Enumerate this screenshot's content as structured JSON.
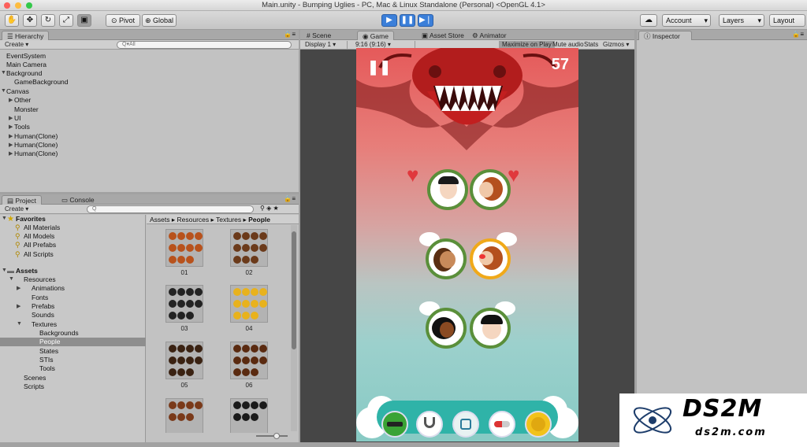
{
  "window": {
    "title": "Main.unity - Bumping Uglies - PC, Mac & Linux Standalone (Personal) <OpenGL 4.1>"
  },
  "toolbar": {
    "pivot_label": "Pivot",
    "global_label": "Global",
    "account_label": "Account",
    "layers_label": "Layers",
    "layout_label": "Layout"
  },
  "hierarchy": {
    "tab_label": "Hierarchy",
    "create_label": "Create",
    "search_placeholder": "Q▾All",
    "items": [
      "EventSystem",
      "Main Camera",
      "Background",
      "GameBackground",
      "Canvas",
      "Other",
      "Monster",
      "UI",
      "Tools",
      "Human(Clone)",
      "Human(Clone)",
      "Human(Clone)"
    ]
  },
  "project": {
    "tab_label": "Project",
    "console_tab_label": "Console",
    "create_label": "Create",
    "favorites_label": "Favorites",
    "favorites": [
      "All Materials",
      "All Models",
      "All Prefabs",
      "All Scripts"
    ],
    "assets_label": "Assets",
    "assets_tree": [
      "Resources",
      "Animations",
      "Fonts",
      "Prefabs",
      "Sounds",
      "Textures",
      "Backgrounds",
      "People",
      "States",
      "STIs",
      "Tools",
      "Scenes",
      "Scripts"
    ],
    "breadcrumb": [
      "Assets",
      "Resources",
      "Textures",
      "People"
    ],
    "thumbnails": [
      "01",
      "02",
      "03",
      "04",
      "05",
      "06",
      "",
      ""
    ]
  },
  "scene_tabs": {
    "scene": "Scene",
    "game": "Game",
    "asset_store": "Asset Store",
    "animator": "Animator"
  },
  "game_bar": {
    "display": "Display 1",
    "aspect": "9:16 (9:16)",
    "maximize": "Maximize on Play",
    "mute": "Mute audio",
    "stats": "Stats",
    "gizmos": "Gizmos"
  },
  "game": {
    "score": "57",
    "pause_icon": "pause-icon",
    "tools": [
      "syringe-icon",
      "stethoscope-icon",
      "soap-icon",
      "pill-icon",
      "coin-icon"
    ]
  },
  "inspector": {
    "tab_label": "Inspector"
  },
  "watermark": {
    "brand": "DS2M",
    "url": "ds2m.com"
  },
  "colors": {
    "accent": "#3b7fd9",
    "circle_green": "#5a8f3a",
    "circle_selected": "#f0a91a",
    "heart": "#e0383d",
    "toolbar_teal": "#2fb3a8"
  }
}
